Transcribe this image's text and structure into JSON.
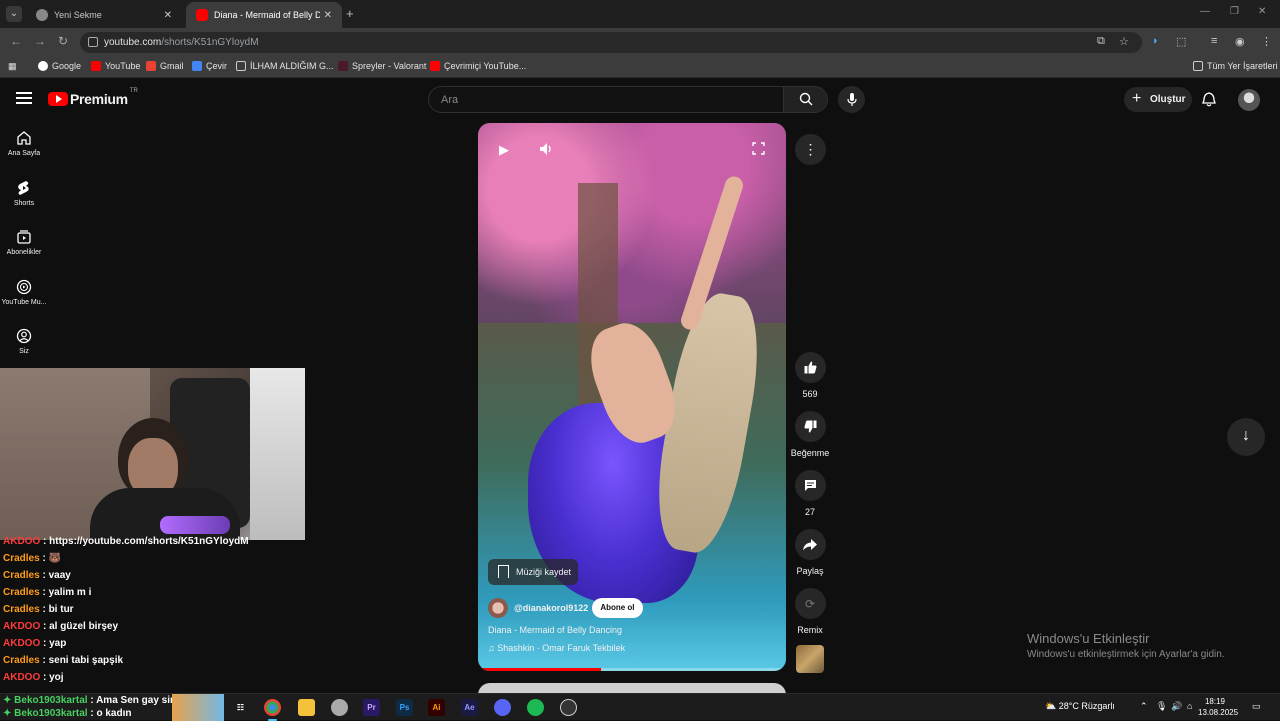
{
  "browser": {
    "tabs": [
      {
        "title": "Yeni Sekme",
        "active": false
      },
      {
        "title": "Diana - Mermaid of Belly Dancing",
        "active": true
      }
    ],
    "url_host": "youtube.com",
    "url_path": "/shorts/K51nGYloydM",
    "bookmarks": [
      "Google",
      "YouTube",
      "Gmail",
      "Çevir",
      "İLHAM ALDIĞIM G...",
      "Spreyler - Valorant",
      "Çevrimiçi YouTube..."
    ],
    "all_bookmarks": "Tüm Yer İşaretleri"
  },
  "youtube": {
    "logo_word": "Premium",
    "logo_region": "TR",
    "search_placeholder": "Ara",
    "create_label": "Oluştur",
    "guide": [
      "Ana Sayfa",
      "Shorts",
      "Abonelikler",
      "YouTube Mu...",
      "Siz"
    ]
  },
  "short": {
    "save_music_label": "Müziği kaydet",
    "channel": "@dianakorol9122",
    "subscribe_label": "Abone ol",
    "title": "Diana - Mermaid of Belly Dancing",
    "music": "Shashkin · Omar Faruk Tekbilek",
    "progress_fraction": 0.4,
    "actions": {
      "likes": "569",
      "dislike_label": "Beğenme",
      "comments": "27",
      "share_label": "Paylaş",
      "remix_label": "Remix"
    }
  },
  "chat": [
    {
      "user": "AKDOO",
      "color": "#ff3b3b",
      "msg": "https://youtube.com/shorts/K51nGYloydM"
    },
    {
      "user": "Cradles",
      "color": "#ff9c1a",
      "msg": "🐻"
    },
    {
      "user": "Cradles",
      "color": "#ff9c1a",
      "msg": "vaay"
    },
    {
      "user": "Cradles",
      "color": "#ff9c1a",
      "msg": "yalim m i"
    },
    {
      "user": "Cradles",
      "color": "#ff9c1a",
      "msg": "bi tur"
    },
    {
      "user": "AKDOO",
      "color": "#ff3b3b",
      "msg": "al güzel birşey"
    },
    {
      "user": "AKDOO",
      "color": "#ff3b3b",
      "msg": "yap"
    },
    {
      "user": "Cradles",
      "color": "#ff9c1a",
      "msg": "seni tabi şapşik"
    },
    {
      "user": "AKDOO",
      "color": "#ff3b3b",
      "msg": "yoj"
    }
  ],
  "taskbar_chat": [
    {
      "user": "Beko1903kartal",
      "msg": "Ama Sen gay sin"
    },
    {
      "user": "Beko1903kartal",
      "msg": "o kadın"
    }
  ],
  "watermark": {
    "title": "Windows'u Etkinleştir",
    "subtitle": "Windows'u etkinleştirmek için Ayarlar'a gidin."
  },
  "system_tray": {
    "weather": "28°C",
    "weather_desc": "Rüzgarlı",
    "time": "18:19",
    "date": "13.08.2025"
  },
  "taskbar_apps": [
    "Chrome",
    "Explorer",
    "Figma",
    "Premiere Pro",
    "Photoshop",
    "Illustrator",
    "After Effects",
    "Discord",
    "Spotify",
    "OBS"
  ]
}
